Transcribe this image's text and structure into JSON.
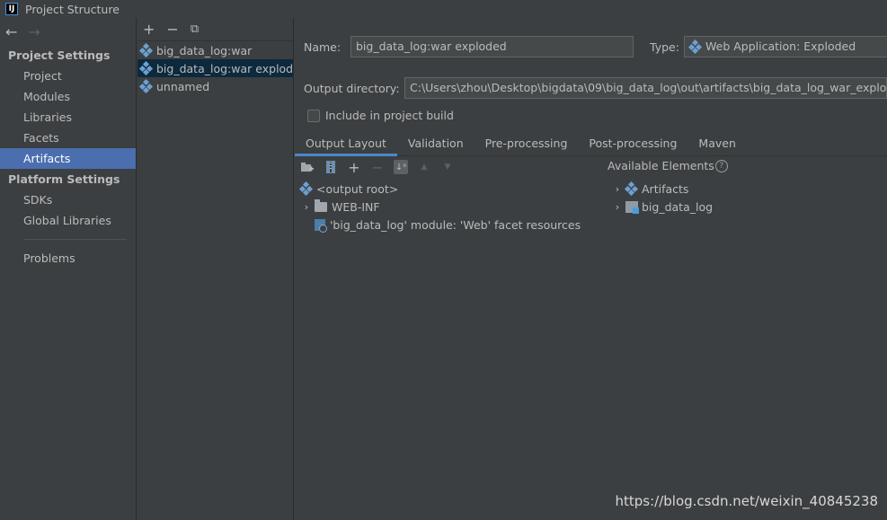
{
  "window": {
    "title": "Project Structure",
    "app_icon": "IJ"
  },
  "nav": {
    "back_icon": "arrow-left",
    "forward_icon": "arrow-right",
    "project_settings_heading": "Project Settings",
    "project_items": [
      "Project",
      "Modules",
      "Libraries",
      "Facets",
      "Artifacts"
    ],
    "selected": "Artifacts",
    "platform_settings_heading": "Platform Settings",
    "platform_items": [
      "SDKs",
      "Global Libraries"
    ],
    "problems": "Problems"
  },
  "artifacts_list": {
    "toolbar_icons": [
      "plus",
      "minus",
      "copy"
    ],
    "items": [
      "big_data_log:war",
      "big_data_log:war exploded",
      "unnamed"
    ],
    "selected_index": 1
  },
  "details": {
    "name_label": "Name:",
    "name_value": "big_data_log:war exploded",
    "type_label": "Type:",
    "type_value": "Web Application: Exploded",
    "output_dir_label": "Output directory:",
    "output_dir_value": "C:\\Users\\zhou\\Desktop\\bigdata\\09\\big_data_log\\out\\artifacts\\big_data_log_war_exploded",
    "include_label": "Include in project build",
    "include_checked": false
  },
  "tabs": [
    "Output Layout",
    "Validation",
    "Pre-processing",
    "Post-processing",
    "Maven"
  ],
  "active_tab": "Output Layout",
  "layout_toolbar": {
    "up_icon": "▲",
    "down_icon": "▼",
    "sort_glyph": "↓ᵃ"
  },
  "output_tree": {
    "root": "<output root>",
    "children": [
      "WEB-INF",
      "'big_data_log' module: 'Web' facet resources"
    ]
  },
  "available": {
    "heading": "Available Elements",
    "items": [
      "Artifacts",
      "big_data_log"
    ]
  },
  "watermark": "https://blog.csdn.net/weixin_40845238",
  "colors": {
    "selection": "#4b6eaf",
    "list_selection": "#0d293e",
    "tab_underline": "#4a88c7",
    "background": "#3c3f41"
  }
}
